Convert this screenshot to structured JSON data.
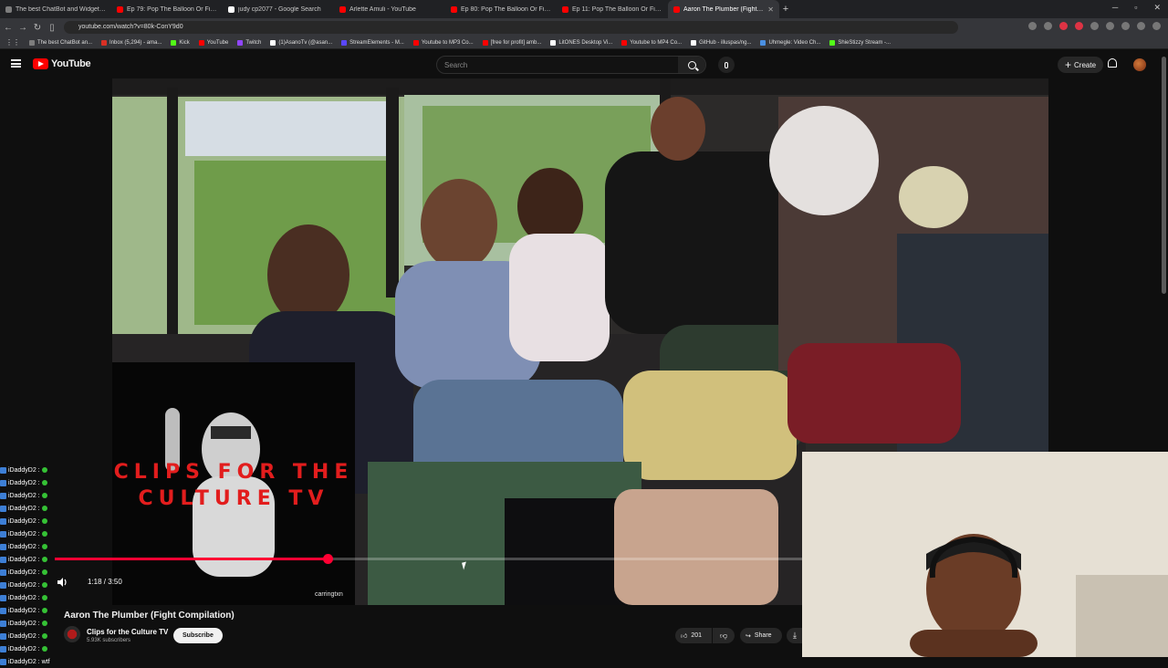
{
  "browser": {
    "tabs": [
      {
        "title": "The best ChatBot and Widgets for Ki",
        "color": "#7d7d7d",
        "active": false
      },
      {
        "title": "Ep 79: Pop The Balloon Or Find Love",
        "color": "#ff0000",
        "active": false
      },
      {
        "title": "judy cp2077 - Google Search",
        "color": "#ffffff",
        "active": false
      },
      {
        "title": "Arlette Amuli - YouTube",
        "color": "#ff0000",
        "active": false
      },
      {
        "title": "Ep 80: Pop The Balloon Or Find Love",
        "color": "#ff0000",
        "active": false
      },
      {
        "title": "Ep 11: Pop The Balloon Or Find Love",
        "color": "#ff0000",
        "active": false
      },
      {
        "title": "Aaron The Plumber (Fight Co",
        "color": "#ff0000",
        "active": true
      }
    ],
    "new_tab": "+",
    "url": "youtube.com/watch?v=80k-ConY9d0",
    "bookmarks": [
      {
        "label": "The best ChatBot an...",
        "color": "#7d7d7d"
      },
      {
        "label": "Inbox (5,294) - ama...",
        "color": "#d93025"
      },
      {
        "label": "Kick",
        "color": "#53fc18"
      },
      {
        "label": "YouTube",
        "color": "#ff0000"
      },
      {
        "label": "Twitch",
        "color": "#9146ff"
      },
      {
        "label": "(1)AsanoTv (@asan...",
        "color": "#ffffff"
      },
      {
        "label": "StreamElements - M...",
        "color": "#5a47ff"
      },
      {
        "label": "Youtube to MP3 Co...",
        "color": "#ff0000"
      },
      {
        "label": "[free for profit] amb...",
        "color": "#ff0000"
      },
      {
        "label": "LitONES Desktop Vi...",
        "color": "#ffffff"
      },
      {
        "label": "Youtube to MP4 Co...",
        "color": "#ff0000"
      },
      {
        "label": "GitHub - illuspas/ng...",
        "color": "#ffffff"
      },
      {
        "label": "Uhmegle: Video Ch...",
        "color": "#4a90e2"
      },
      {
        "label": "ShieStizzy Stream -...",
        "color": "#53fc18"
      }
    ]
  },
  "youtube": {
    "logo_text": "YouTube",
    "search_placeholder": "Search",
    "create_label": "Create"
  },
  "video": {
    "overlay_text": "CLIPS FOR THE CULTURE TV",
    "watermark": "carringtxn",
    "time": "1:18 / 3:50",
    "progress": 0.365,
    "title": "Aaron The Plumber (Fight Compilation)",
    "channel": "Clips for the Culture TV",
    "subscribers": "5.93K subscribers",
    "subscribe_label": "Subscribe",
    "likes": "201",
    "share_label": "Share"
  },
  "chat": {
    "lines": [
      "iDaddyD2 :",
      "iDaddyD2 :",
      "iDaddyD2 :",
      "iDaddyD2 :",
      "iDaddyD2 :",
      "iDaddyD2 :",
      "iDaddyD2 :",
      "iDaddyD2 :",
      "iDaddyD2 :",
      "iDaddyD2 :",
      "iDaddyD2 :",
      "iDaddyD2 :",
      "iDaddyD2 :",
      "iDaddyD2 :",
      "iDaddyD2 :"
    ],
    "last_line": "iDaddyD2 : wtf"
  }
}
